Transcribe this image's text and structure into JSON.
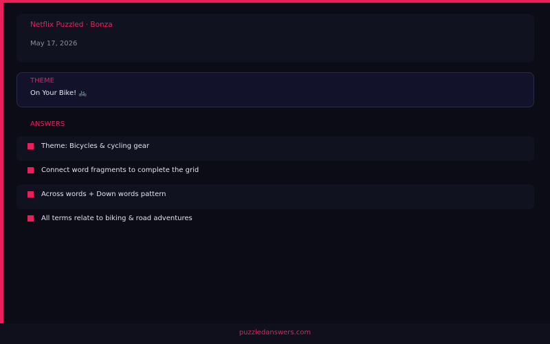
{
  "header": {
    "title": "Netflix Puzzled · Bonza",
    "date": "May 17, 2026"
  },
  "theme": {
    "label": "THEME",
    "value": "On Your Bike! 🚲"
  },
  "answers": {
    "label": "ANSWERS",
    "items": [
      {
        "text": "Theme: Bicycles & cycling gear"
      },
      {
        "text": "Connect word fragments to complete the grid"
      },
      {
        "text": "Across words + Down words pattern"
      },
      {
        "text": "All terms relate to biking & road adventures"
      }
    ]
  },
  "footer": {
    "link": "puzzledanswers.com"
  },
  "colors": {
    "accent": "#ea1f5c",
    "background": "#0b0c16",
    "card": "#11121f"
  }
}
